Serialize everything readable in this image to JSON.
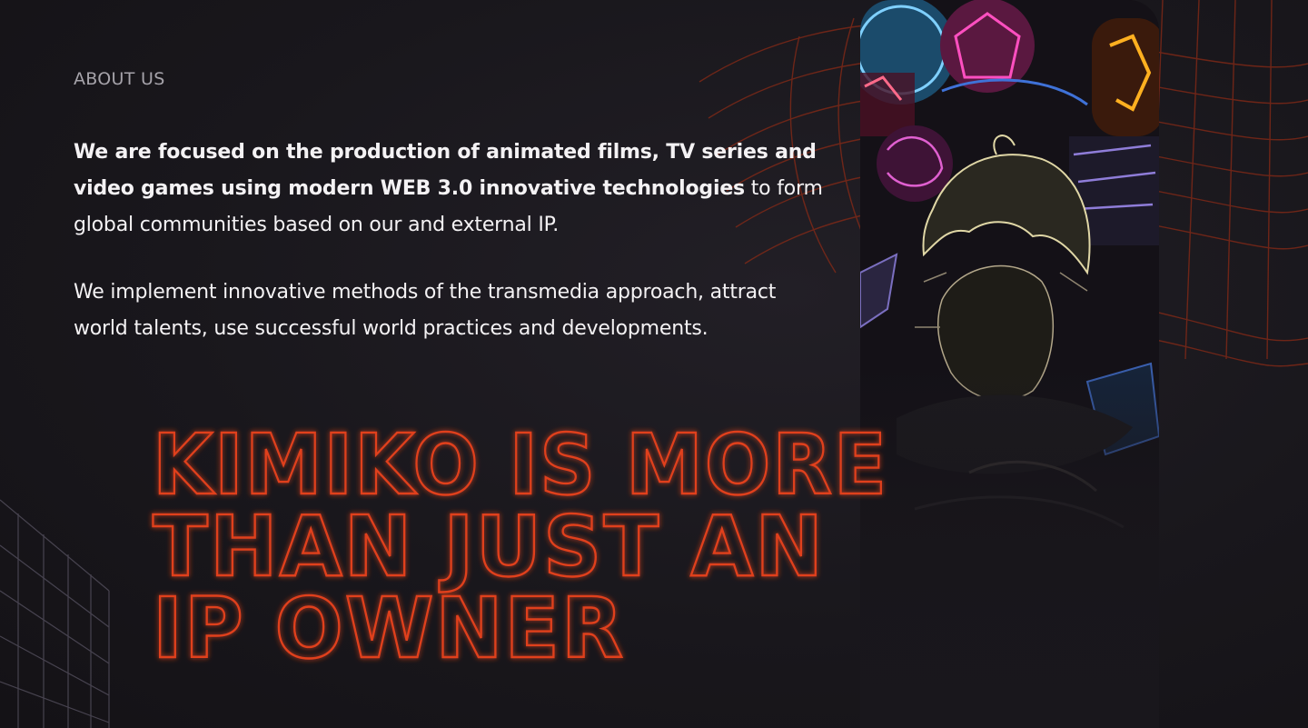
{
  "about": {
    "label": "ABOUT US",
    "intro_bold": "We are focused on the production of animated films, TV series and video games using modern WEB 3.0 innovative technologies",
    "intro_regular": " to form global communities based on our and external IP.",
    "paragraph2": "We implement innovative methods of the transmedia approach, attract world talents, use successful world practices and developments."
  },
  "headline": {
    "line1": "KIMIKO IS MORE",
    "line2": "THAN JUST AN",
    "line3": "IP OWNER"
  },
  "art": {
    "icon": "anime-neon-collage-image"
  },
  "colors": {
    "background": "#19171c",
    "accent_neon": "#e0401c",
    "text": "#f4f2f4",
    "label": "#a6a3aa"
  }
}
